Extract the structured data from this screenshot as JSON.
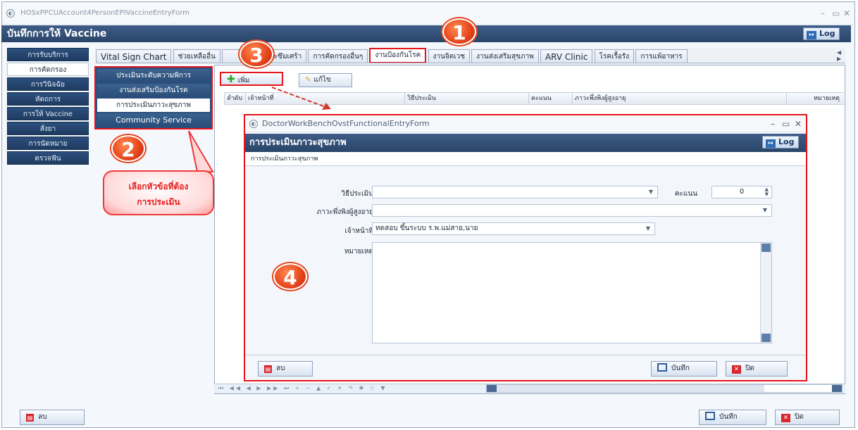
{
  "window": {
    "title": "HOSxPPCUAccount4PersonEPIVaccineEntryForm",
    "header": "บันทึกการให้ Vaccine",
    "log_label": "Log",
    "min": "–",
    "max": "▭",
    "close": "✕"
  },
  "left_nav": [
    {
      "label": "การรับบริการ"
    },
    {
      "label": "การคัดกรอง"
    },
    {
      "label": "การวินิจฉัย"
    },
    {
      "label": "หัตถการ"
    },
    {
      "label": "การให้ Vaccine"
    },
    {
      "label": "สั่งยา"
    },
    {
      "label": "การนัดหมาย"
    },
    {
      "label": "ตรวจฟัน"
    }
  ],
  "tabs": [
    {
      "label": "Vital Sign Chart"
    },
    {
      "label": "ช่วยเหลืออื่น"
    },
    {
      "label": "องภาวะซึมเศร้า"
    },
    {
      "label": "การคัดกรองอื่นๆ"
    },
    {
      "label": "งานป้องกันโรค"
    },
    {
      "label": "งานจิตเวช"
    },
    {
      "label": "งานส่งเสริมสุขภาพ"
    },
    {
      "label": "ARV Clinic"
    },
    {
      "label": "โรคเรื้อรัง"
    },
    {
      "label": "การแพ้อาหาร"
    }
  ],
  "tab_scroll": "◀ ▶",
  "sub_nav": [
    {
      "label": "ประเมินระดับความพิการ"
    },
    {
      "label": "งานส่งเสริมป้องกันโรค"
    },
    {
      "label": "การประเมินภาวะสุขภาพ"
    },
    {
      "label": "Community Service"
    }
  ],
  "toolbar": {
    "add": "เพิ่ม",
    "edit": "แก้ไข"
  },
  "grid_columns": [
    "ลำดับ",
    "เจ้าหน้าที่",
    "วิธีประเมิน",
    "คะแนน",
    "ภาวะพึ่งพิงผู้สูงอายุ",
    "หมายเหตุ"
  ],
  "navigator": "⏮ ◀◀ ◀ ▶ ▶▶ ⏭ + − ▲ ✓ ✕ ↷ ✱ ☆ ▼",
  "bottom": {
    "delete": "ลบ",
    "save": "บันทึก",
    "close": "ปิด"
  },
  "dialog": {
    "title": "DoctorWorkBenchOvstFunctionalEntryForm",
    "header": "การประเมินภาวะสุขภาพ",
    "subtitle": "การประเมินภาวะสุขภาพ",
    "log_label": "Log",
    "fields": {
      "method_label": "วิธีประเมิน",
      "method_value": "",
      "score_label": "คะแนน",
      "score_value": "0",
      "dependency_label": "ภาวะพึ่งพิงผู้สูงอายุ",
      "dependency_value": "",
      "staff_label": "เจ้าหน้าที่",
      "staff_value": "ทดสอบ ขึ้นระบบ ร.พ.แม่สาย,นาย",
      "note_label": "หมายเหตุ"
    },
    "buttons": {
      "delete": "ลบ",
      "save": "บันทึก",
      "close": "ปิด"
    }
  },
  "callouts": {
    "b1": "1",
    "b2": "2",
    "b3": "3",
    "b4": "4",
    "bubble_line1": "เลือกหัวข้อที่ต้อง",
    "bubble_line2": "การประเมิน"
  },
  "colors": {
    "accent_red": "#e5151b",
    "header_blue": "#2a4569",
    "badge_orange": "#e5441c"
  }
}
